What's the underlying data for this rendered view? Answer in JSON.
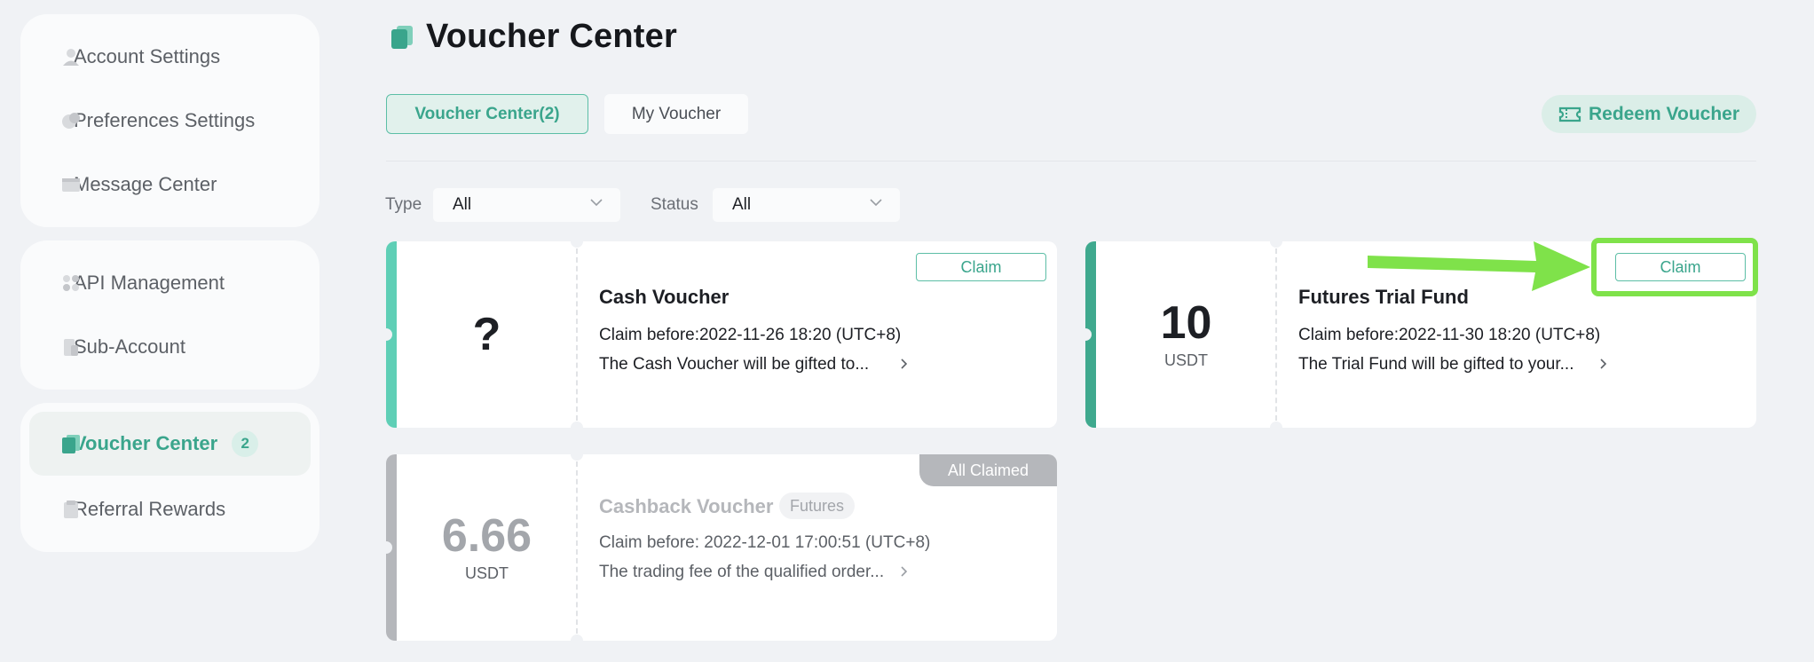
{
  "sidebar": {
    "group1": [
      {
        "label": "Account Settings",
        "icon": "user-icon"
      },
      {
        "label": "Preferences Settings",
        "icon": "preferences-icon"
      },
      {
        "label": "Message Center",
        "icon": "message-icon"
      }
    ],
    "group2": [
      {
        "label": "API Management",
        "icon": "api-icon"
      },
      {
        "label": "Sub-Account",
        "icon": "sub-account-icon"
      }
    ],
    "group3": [
      {
        "label": "Voucher Center",
        "icon": "voucher-icon",
        "badge": "2",
        "active": true
      },
      {
        "label": "Referral Rewards",
        "icon": "referral-icon"
      }
    ]
  },
  "header": {
    "title": "Voucher Center",
    "title_icon": "voucher-icon"
  },
  "tabs": [
    {
      "label": "Voucher Center(2)",
      "active": true
    },
    {
      "label": "My Voucher",
      "active": false
    }
  ],
  "redeem_button": {
    "label": "Redeem Voucher",
    "icon": "ticket-icon"
  },
  "filters": {
    "type": {
      "label": "Type",
      "value": "All"
    },
    "status": {
      "label": "Status",
      "value": "All"
    }
  },
  "vouchers": [
    {
      "amount": "?",
      "unit": "",
      "title": "Cash Voucher",
      "claim_before": "Claim before:2022-11-26 18:20 (UTC+8)",
      "description": "The Cash Voucher will be gifted to...",
      "action": "Claim"
    },
    {
      "amount": "10",
      "unit": "USDT",
      "title": "Futures Trial Fund",
      "claim_before": "Claim before:2022-11-30 18:20 (UTC+8)",
      "description": "The Trial Fund will be gifted to your...",
      "action": "Claim"
    },
    {
      "amount": "6.66",
      "unit": "USDT",
      "title": "Cashback Voucher",
      "tag": "Futures",
      "claim_before": "Claim before: 2022-12-01 17:00:51 (UTC+8)",
      "description": "The trading fee of the qualified order...",
      "status": "All Claimed"
    }
  ],
  "colors": {
    "accent": "#3aa58c",
    "accent_light": "#e1f1ec",
    "stripe_cash": "#5fcfb6",
    "stripe_futures": "#3fa98e",
    "stripe_claimed": "#b5b7bb",
    "highlight": "#7fe24a",
    "background": "#f0f2f5"
  }
}
